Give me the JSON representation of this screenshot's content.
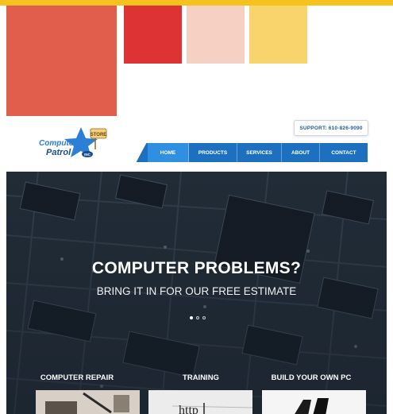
{
  "palette": {
    "top_bar": "#f6c21d",
    "swatches": [
      "#e05e4b",
      "#dd3334",
      "#f5d0c3",
      "#f9d46c"
    ]
  },
  "site": {
    "logo": {
      "icon": "computer-patrol-star-logo-icon",
      "line1": "Computer",
      "line2": "Patrol",
      "badge": "STORE",
      "tag": "INC"
    },
    "support_label": "SUPPORT: 610-826-9090",
    "nav": {
      "accent": "#1d6fc0",
      "active_color": "#2f8fe0",
      "items": [
        {
          "label": "HOME",
          "active": true
        },
        {
          "label": "PRODUCTS",
          "active": false
        },
        {
          "label": "SERVICES",
          "active": false
        },
        {
          "label": "ABOUT",
          "active": false
        },
        {
          "label": "CONTACT",
          "active": false
        }
      ]
    }
  },
  "hero": {
    "background": "circuit-board-photo",
    "title": "COMPUTER PROBLEMS?",
    "subtitle": "BRING IT IN FOR OUR FREE ESTIMATE",
    "slider_dots": [
      {
        "active": true
      },
      {
        "active": false
      },
      {
        "active": false
      }
    ]
  },
  "services": [
    {
      "title": "COMPUTER REPAIR",
      "image": "repair-tools-photo"
    },
    {
      "title": "TRAINING",
      "image": "http-screen-photo",
      "image_text": "http"
    },
    {
      "title": "BUILD YOUR OWN PC",
      "image": "pc-case-photo"
    }
  ]
}
